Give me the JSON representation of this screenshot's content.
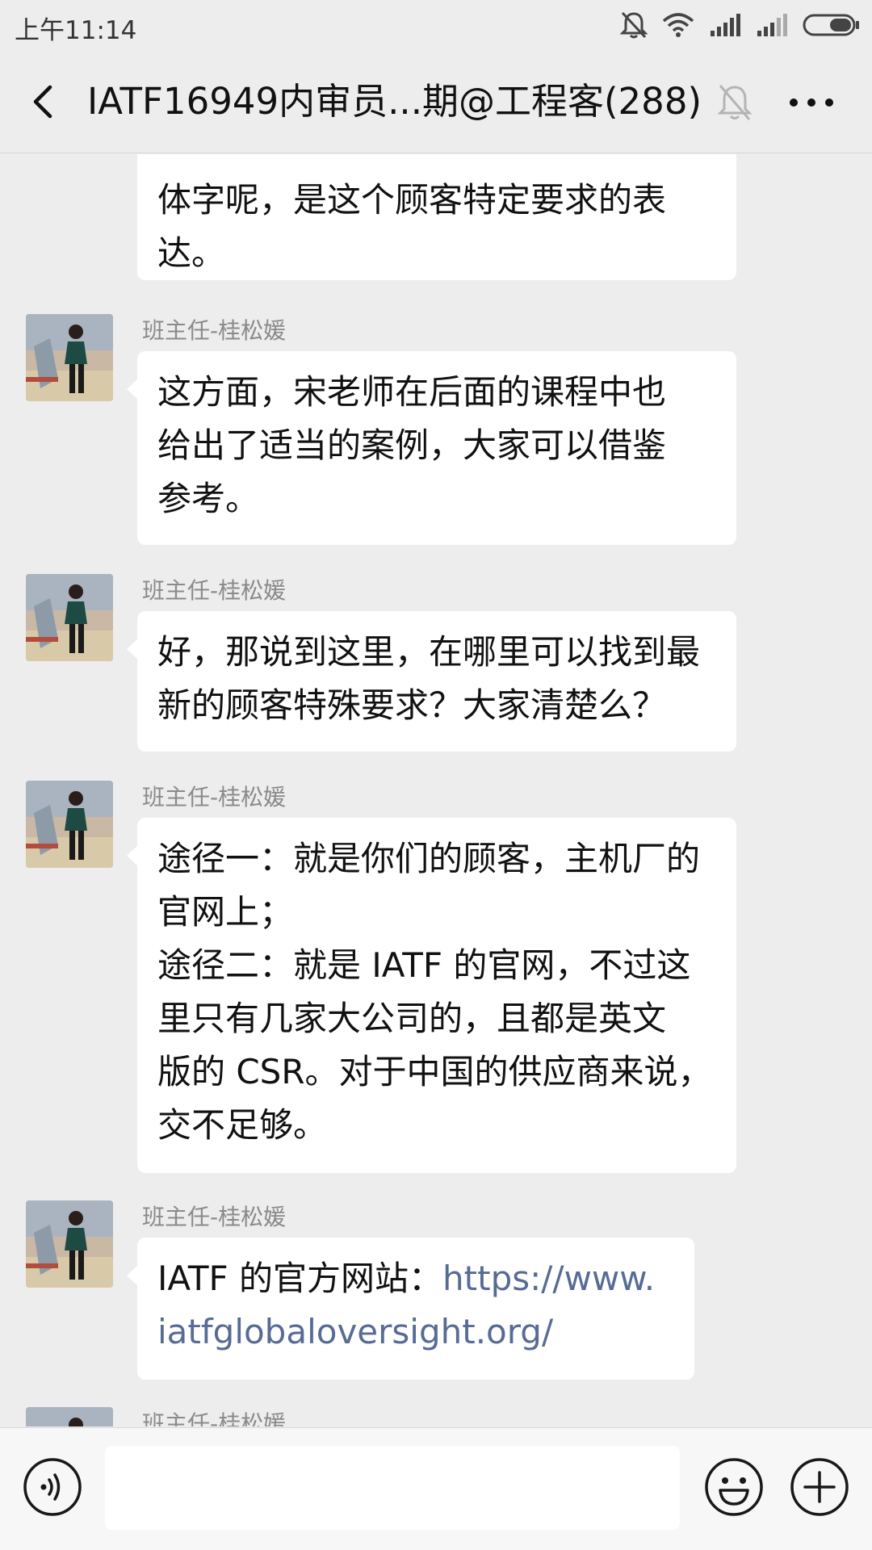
{
  "status_bar": {
    "time": "上午11:14",
    "icons": [
      "bell-off-icon",
      "wifi-icon",
      "signal-icon",
      "signal-icon",
      "battery-icon"
    ]
  },
  "header": {
    "back_icon": "chevron-left-icon",
    "title": "IATF16949内审员...期@工程客(288)",
    "mute_icon": "bell-off-icon",
    "more_icon": "more-dots-icon"
  },
  "messages": [
    {
      "sender": "",
      "lines": [
        "体字呢，是这个顾客特定要求的表",
        "达。"
      ]
    },
    {
      "sender": "班主任-桂松媛",
      "lines": [
        "这方面，宋老师在后面的课程中也",
        "给出了适当的案例，大家可以借鉴",
        "参考。"
      ]
    },
    {
      "sender": "班主任-桂松媛",
      "lines": [
        "好，那说到这里，在哪里可以找到最",
        "新的顾客特殊要求？大家清楚么？"
      ]
    },
    {
      "sender": "班主任-桂松媛",
      "lines": [
        "途径一：就是你们的顾客，主机厂的",
        "官网上；",
        "途径二：就是 IATF 的官网，不过这",
        "里只有几家大公司的，且都是英文",
        "版的 CSR。对于中国的供应商来说，",
        "交不足够。"
      ]
    },
    {
      "sender": "班主任-桂松媛",
      "text_prefix": "IATF 的官方网站：",
      "link_line1": "https://www.",
      "link_line2": "iatfglobaloversight.org/"
    },
    {
      "sender": "班主任-桂松媛"
    }
  ],
  "input_bar": {
    "voice_icon": "voice-icon",
    "input_value": "",
    "emoji_icon": "emoji-icon",
    "plus_icon": "plus-circle-icon"
  },
  "colors": {
    "background": "#ededed",
    "bubble": "#ffffff",
    "link": "#576b95",
    "sender_name": "#8a8a8a"
  }
}
